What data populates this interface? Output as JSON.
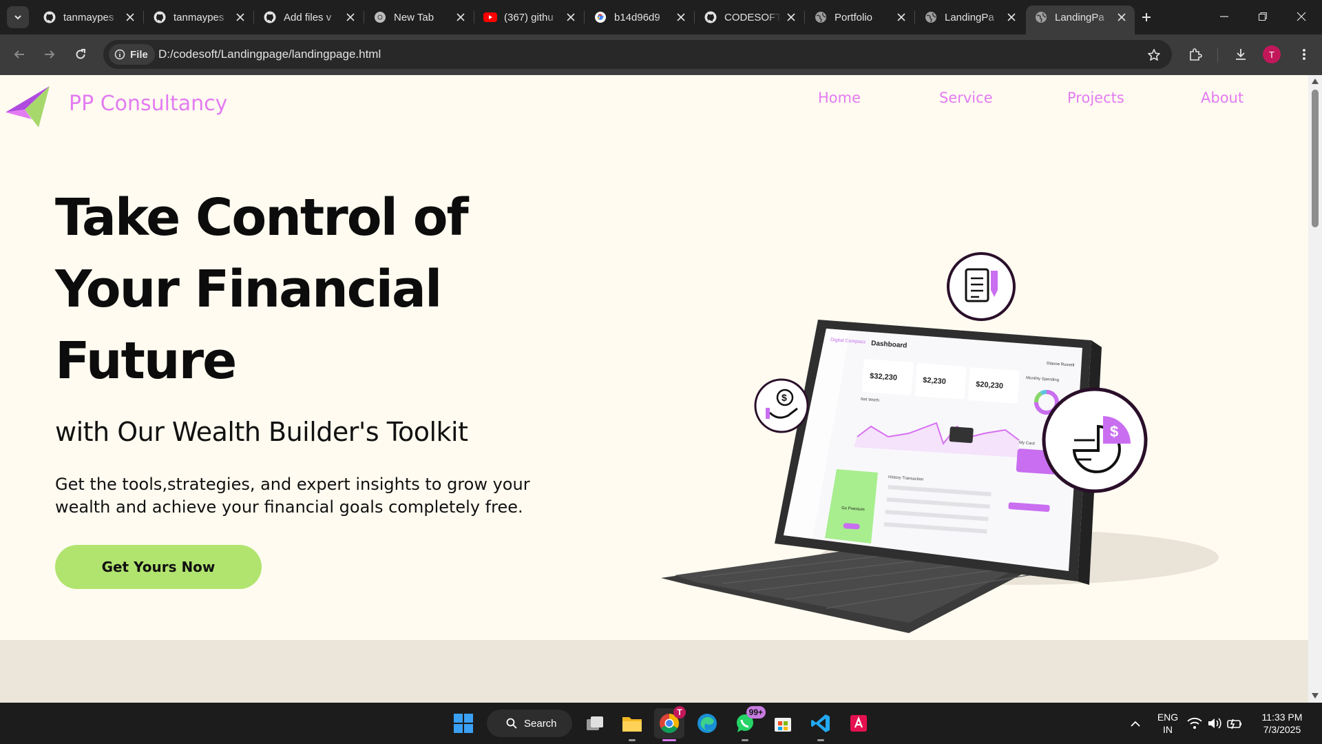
{
  "browser": {
    "tabs": [
      {
        "title": "tanmaypes",
        "icon": "github-icon"
      },
      {
        "title": "tanmaypes",
        "icon": "github-icon"
      },
      {
        "title": "Add files v",
        "icon": "github-icon"
      },
      {
        "title": "New Tab",
        "icon": "chrome-icon"
      },
      {
        "title": "(367) githu",
        "icon": "youtube-icon"
      },
      {
        "title": "b14d96d9",
        "icon": "google-icon"
      },
      {
        "title": "CODESOFT",
        "icon": "github-icon"
      },
      {
        "title": "Portfolio",
        "icon": "globe-icon"
      },
      {
        "title": "LandingPa",
        "icon": "globe-icon"
      },
      {
        "title": "LandingPa",
        "icon": "globe-icon",
        "active": true
      }
    ],
    "security_chip": "File",
    "url": "D:/codesoft/Landingpage/landingpage.html",
    "profile_initial": "T"
  },
  "page": {
    "brand": "PP Consultancy",
    "nav": [
      "Home",
      "Service",
      "Projects",
      "About"
    ],
    "hero": {
      "title_line1": "Take Control of",
      "title_line2": "Your Financial",
      "title_line3": "Future",
      "subtitle": "with Our Wealth Builder's Toolkit",
      "description": "Get the tools,strategies, and expert insights to grow your wealth and achieve your financial goals completely free.",
      "cta": "Get Yours Now"
    },
    "dashboard": {
      "title": "Dashboard",
      "brand": "Digital Compass",
      "user": "Dianne Russell",
      "stats": [
        "$32,230",
        "$2,230",
        "$20,230"
      ],
      "chart_label": "Net Worth",
      "spending_label": "Monthly Spending",
      "card_label": "My Card",
      "history_label": "History Transaction",
      "premium_label": "Go Premium"
    },
    "colors": {
      "accent": "#e37bf2",
      "cta": "#b1e46f",
      "bg": "#fffbf0",
      "band": "#ece6da"
    }
  },
  "taskbar": {
    "search_label": "Search",
    "whatsapp_badge": "99+",
    "chrome_badge": "T",
    "lang_line1": "ENG",
    "lang_line2": "IN",
    "time": "11:33 PM",
    "date": "7/3/2025"
  }
}
